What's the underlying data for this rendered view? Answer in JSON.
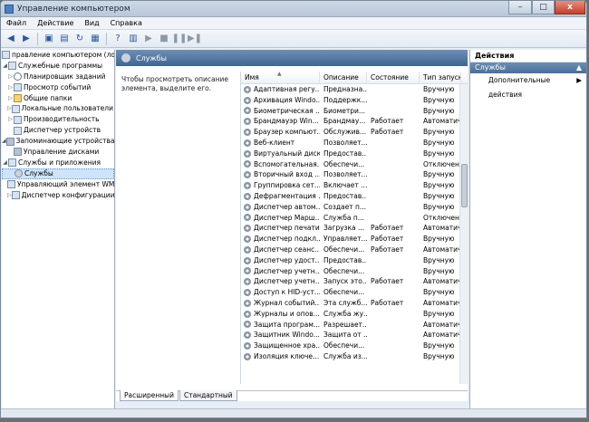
{
  "window": {
    "title": "Управление компьютером",
    "minimize": "–",
    "maximize": "□",
    "close": "x"
  },
  "menu": [
    "Файл",
    "Действие",
    "Вид",
    "Справка"
  ],
  "tree": [
    {
      "label": "правление компьютером (локаль",
      "level": 0,
      "icon": "computer-icon",
      "expander": ""
    },
    {
      "label": "Служебные программы",
      "level": 0,
      "icon": "tools-icon",
      "expander": "◢"
    },
    {
      "label": "Планировщик заданий",
      "level": 1,
      "icon": "clock-icon",
      "expander": "▷"
    },
    {
      "label": "Просмотр событий",
      "level": 1,
      "icon": "event-viewer-icon",
      "expander": "▷"
    },
    {
      "label": "Общие папки",
      "level": 1,
      "icon": "folder-icon",
      "expander": "▷"
    },
    {
      "label": "Локальные пользователи и",
      "level": 1,
      "icon": "users-icon",
      "expander": "▷"
    },
    {
      "label": "Производительность",
      "level": 1,
      "icon": "performance-icon",
      "expander": "▷"
    },
    {
      "label": "Диспетчер устройств",
      "level": 1,
      "icon": "device-manager-icon",
      "expander": ""
    },
    {
      "label": "Запоминающие устройства",
      "level": 0,
      "icon": "storage-icon",
      "expander": "◢"
    },
    {
      "label": "Управление дисками",
      "level": 1,
      "icon": "disk-icon",
      "expander": ""
    },
    {
      "label": "Службы и приложения",
      "level": 0,
      "icon": "services-apps-icon",
      "expander": "◢"
    },
    {
      "label": "Службы",
      "level": 1,
      "icon": "gear-icon",
      "expander": "",
      "selected": true
    },
    {
      "label": "Управляющий элемент WM",
      "level": 1,
      "icon": "wmi-icon",
      "expander": ""
    },
    {
      "label": "Диспетчер конфигурации SC",
      "level": 1,
      "icon": "config-icon",
      "expander": "▷"
    }
  ],
  "services_header": "Службы",
  "description_text": "Чтобы просмотреть описание элемента, выделите его.",
  "columns": [
    "Имя",
    "Описание",
    "Состояние",
    "Тип запуска"
  ],
  "rows": [
    [
      "Адаптивная регу...",
      "Предназна...",
      "",
      "Вручную"
    ],
    [
      "Архивация Windo...",
      "Поддержк...",
      "",
      "Вручную"
    ],
    [
      "Биометрическая ...",
      "Биометри...",
      "",
      "Вручную"
    ],
    [
      "Брандмауэр Win...",
      "Брандмау...",
      "Работает",
      "Автоматически"
    ],
    [
      "Браузер компьют...",
      "Обслужив...",
      "Работает",
      "Вручную"
    ],
    [
      "Веб-клиент",
      "Позволяет...",
      "",
      "Вручную"
    ],
    [
      "Виртуальный диск",
      "Предостав...",
      "",
      "Вручную"
    ],
    [
      "Вспомогательная...",
      "Обеспечи...",
      "",
      "Отключена"
    ],
    [
      "Вторичный вход ...",
      "Позволяет...",
      "",
      "Вручную"
    ],
    [
      "Группировка сет...",
      "Включает ...",
      "",
      "Вручную"
    ],
    [
      "Дефрагментация ...",
      "Предостав...",
      "",
      "Вручную"
    ],
    [
      "Диспетчер автом...",
      "Создает п...",
      "",
      "Вручную"
    ],
    [
      "Диспетчер Марш...",
      "Служба п...",
      "",
      "Отключена"
    ],
    [
      "Диспетчер печати",
      "Загрузка ...",
      "Работает",
      "Автоматически"
    ],
    [
      "Диспетчер подкл...",
      "Управляет...",
      "Работает",
      "Вручную"
    ],
    [
      "Диспетчер сеанс...",
      "Обеспечи...",
      "Работает",
      "Автоматически"
    ],
    [
      "Диспетчер удост...",
      "Предостав...",
      "",
      "Вручную"
    ],
    [
      "Диспетчер учетн...",
      "Обеспечи...",
      "",
      "Вручную"
    ],
    [
      "Диспетчер учетн...",
      "Запуск это...",
      "Работает",
      "Автоматически"
    ],
    [
      "Доступ к HID-уст...",
      "Обеспечи...",
      "",
      "Вручную"
    ],
    [
      "Журнал событий...",
      "Эта служб...",
      "Работает",
      "Автоматически"
    ],
    [
      "Журналы и опов...",
      "Служба жу...",
      "",
      "Вручную"
    ],
    [
      "Защита програм...",
      "Разрешает...",
      "",
      "Автоматически"
    ],
    [
      "Защитник Windo...",
      "Защита от ...",
      "",
      "Автоматически"
    ],
    [
      "Защищенное хра...",
      "Обеспечи...",
      "",
      "Вручную"
    ],
    [
      "Изоляция ключе...",
      "Служба из...",
      "",
      "Вручную"
    ]
  ],
  "tabs": [
    "Расширенный",
    "Стандартный"
  ],
  "actions": {
    "title": "Действия",
    "group": "Службы",
    "more": "Дополнительные действия"
  }
}
